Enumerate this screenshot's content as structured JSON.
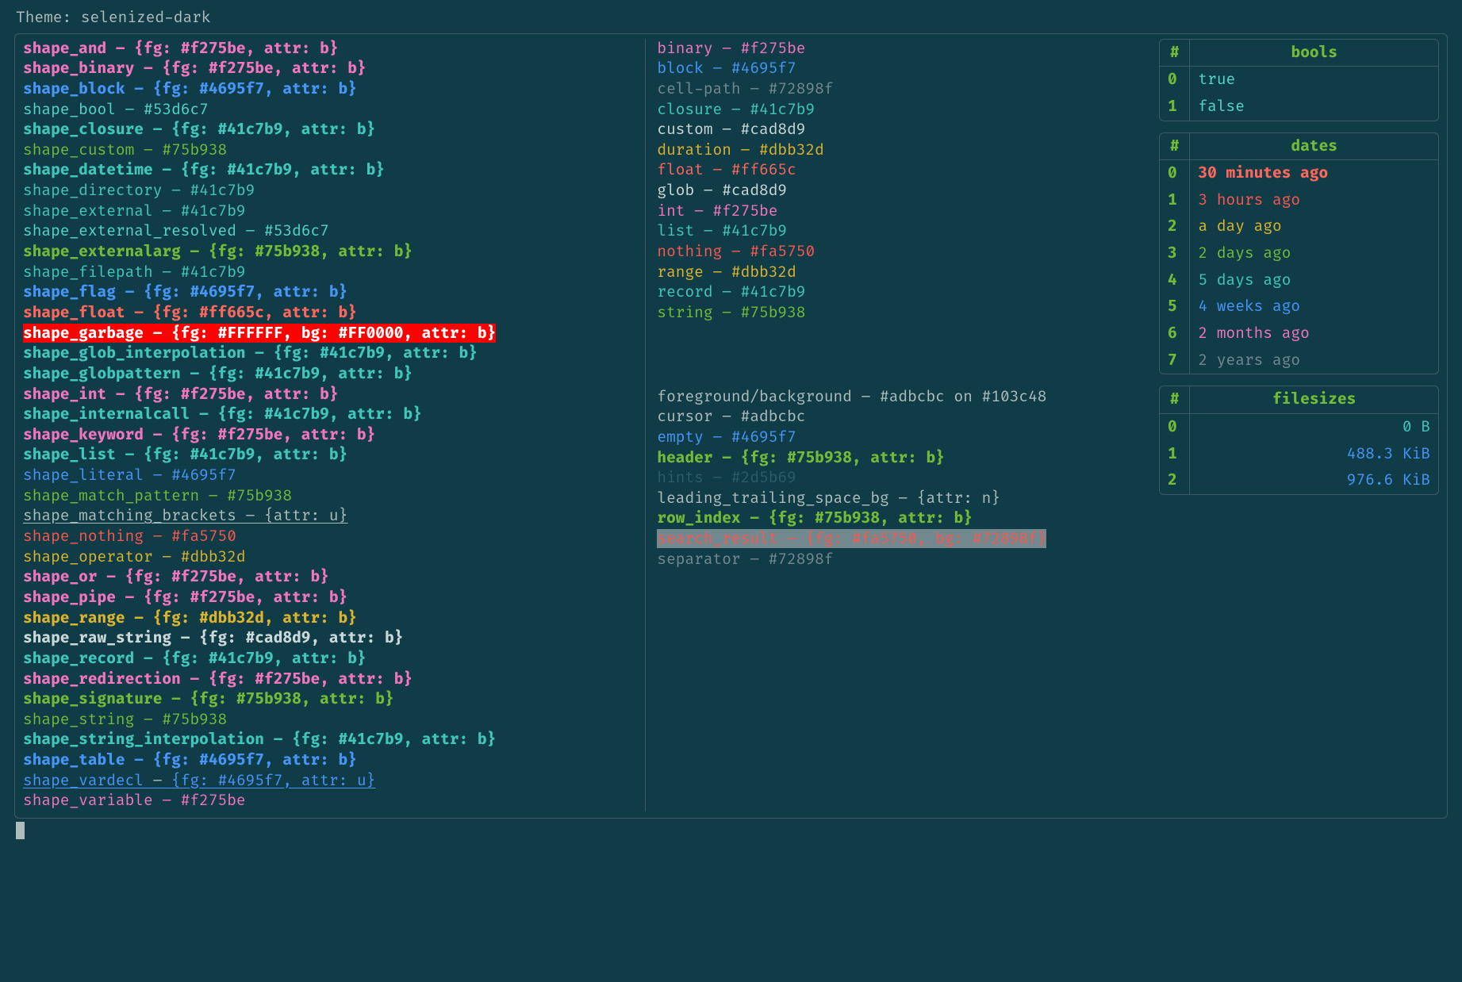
{
  "theme_label": "Theme: ",
  "theme_name": "selenized-dark",
  "colors": {
    "bg": "#103c48",
    "fg": "#adbcbc",
    "muted": "#72898f",
    "green": "#75b938",
    "cyan": "#41c7b9",
    "brcyan": "#53d6c7",
    "blue": "#4695f7",
    "magenta": "#f275be",
    "yellow": "#dbb32d",
    "red": "#fa5750",
    "brred": "#ff665c",
    "white": "#cad8d9",
    "dim": "#2d5b69"
  },
  "shapes": [
    {
      "name": "shape_and",
      "value": "{fg: #f275be, attr: b}",
      "c": "magenta",
      "b": true
    },
    {
      "name": "shape_binary",
      "value": "{fg: #f275be, attr: b}",
      "c": "magenta",
      "b": true
    },
    {
      "name": "shape_block",
      "value": "{fg: #4695f7, attr: b}",
      "c": "blue",
      "b": true
    },
    {
      "name": "shape_bool",
      "value": "#53d6c7",
      "c": "brcyan",
      "b": false
    },
    {
      "name": "shape_closure",
      "value": "{fg: #41c7b9, attr: b}",
      "c": "cyan",
      "b": true
    },
    {
      "name": "shape_custom",
      "value": "#75b938",
      "c": "green",
      "b": false
    },
    {
      "name": "shape_datetime",
      "value": "{fg: #41c7b9, attr: b}",
      "c": "cyan",
      "b": true
    },
    {
      "name": "shape_directory",
      "value": "#41c7b9",
      "c": "cyan",
      "b": false
    },
    {
      "name": "shape_external",
      "value": "#41c7b9",
      "c": "cyan",
      "b": false
    },
    {
      "name": "shape_external_resolved",
      "value": "#53d6c7",
      "c": "brcyan",
      "b": false
    },
    {
      "name": "shape_externalarg",
      "value": "{fg: #75b938, attr: b}",
      "c": "green",
      "b": true
    },
    {
      "name": "shape_filepath",
      "value": "#41c7b9",
      "c": "cyan",
      "b": false
    },
    {
      "name": "shape_flag",
      "value": "{fg: #4695f7, attr: b}",
      "c": "blue",
      "b": true
    },
    {
      "name": "shape_float",
      "value": "{fg: #ff665c, attr: b}",
      "c": "brred",
      "b": true
    },
    {
      "name": "shape_garbage",
      "value": "{fg: #FFFFFF, bg: #FF0000, attr: b}",
      "c": "#FFFFFF",
      "bg": "#FF0000",
      "b": true
    },
    {
      "name": "shape_glob_interpolation",
      "value": "{fg: #41c7b9, attr: b}",
      "c": "cyan",
      "b": true
    },
    {
      "name": "shape_globpattern",
      "value": "{fg: #41c7b9, attr: b}",
      "c": "cyan",
      "b": true
    },
    {
      "name": "shape_int",
      "value": "{fg: #f275be, attr: b}",
      "c": "magenta",
      "b": true
    },
    {
      "name": "shape_internalcall",
      "value": "{fg: #41c7b9, attr: b}",
      "c": "cyan",
      "b": true
    },
    {
      "name": "shape_keyword",
      "value": "{fg: #f275be, attr: b}",
      "c": "magenta",
      "b": true
    },
    {
      "name": "shape_list",
      "value": "{fg: #41c7b9, attr: b}",
      "c": "cyan",
      "b": true
    },
    {
      "name": "shape_literal",
      "value": "#4695f7",
      "c": "blue",
      "b": false
    },
    {
      "name": "shape_match_pattern",
      "value": "#75b938",
      "c": "green",
      "b": false
    },
    {
      "name": "shape_matching_brackets",
      "value": "{attr: u}",
      "c": "fg",
      "b": false,
      "u": true
    },
    {
      "name": "shape_nothing",
      "value": "#fa5750",
      "c": "red",
      "b": false
    },
    {
      "name": "shape_operator",
      "value": "#dbb32d",
      "c": "yellow",
      "b": false
    },
    {
      "name": "shape_or",
      "value": "{fg: #f275be, attr: b}",
      "c": "magenta",
      "b": true
    },
    {
      "name": "shape_pipe",
      "value": "{fg: #f275be, attr: b}",
      "c": "magenta",
      "b": true
    },
    {
      "name": "shape_range",
      "value": "{fg: #dbb32d, attr: b}",
      "c": "yellow",
      "b": true
    },
    {
      "name": "shape_raw_string",
      "value": "{fg: #cad8d9, attr: b}",
      "c": "white",
      "b": true
    },
    {
      "name": "shape_record",
      "value": "{fg: #41c7b9, attr: b}",
      "c": "cyan",
      "b": true
    },
    {
      "name": "shape_redirection",
      "value": "{fg: #f275be, attr: b}",
      "c": "magenta",
      "b": true
    },
    {
      "name": "shape_signature",
      "value": "{fg: #75b938, attr: b}",
      "c": "green",
      "b": true
    },
    {
      "name": "shape_string",
      "value": "#75b938",
      "c": "green",
      "b": false
    },
    {
      "name": "shape_string_interpolation",
      "value": "{fg: #41c7b9, attr: b}",
      "c": "cyan",
      "b": true
    },
    {
      "name": "shape_table",
      "value": "{fg: #4695f7, attr: b}",
      "c": "blue",
      "b": true
    },
    {
      "name": "shape_vardecl",
      "value": "{fg: #4695f7, attr: u}",
      "c": "blue",
      "b": false,
      "u": true
    },
    {
      "name": "shape_variable",
      "value": "#f275be",
      "c": "magenta",
      "b": false
    }
  ],
  "types": [
    {
      "name": "binary",
      "value": "#f275be",
      "c": "magenta"
    },
    {
      "name": "block",
      "value": "#4695f7",
      "c": "blue"
    },
    {
      "name": "cell-path",
      "value": "#72898f",
      "c": "muted"
    },
    {
      "name": "closure",
      "value": "#41c7b9",
      "c": "cyan"
    },
    {
      "name": "custom",
      "value": "#cad8d9",
      "c": "white"
    },
    {
      "name": "duration",
      "value": "#dbb32d",
      "c": "yellow"
    },
    {
      "name": "float",
      "value": "#ff665c",
      "c": "brred"
    },
    {
      "name": "glob",
      "value": "#cad8d9",
      "c": "white"
    },
    {
      "name": "int",
      "value": "#f275be",
      "c": "magenta"
    },
    {
      "name": "list",
      "value": "#41c7b9",
      "c": "cyan"
    },
    {
      "name": "nothing",
      "value": "#fa5750",
      "c": "red"
    },
    {
      "name": "range",
      "value": "#dbb32d",
      "c": "yellow"
    },
    {
      "name": "record",
      "value": "#41c7b9",
      "c": "cyan"
    },
    {
      "name": "string",
      "value": "#75b938",
      "c": "green"
    }
  ],
  "misc": [
    {
      "name": "foreground/background",
      "value": "#adbcbc on #103c48",
      "c": "fg"
    },
    {
      "name": "cursor",
      "value": "#adbcbc",
      "c": "fg"
    },
    {
      "name": "empty",
      "value": "#4695f7",
      "c": "blue"
    },
    {
      "name": "header",
      "value": "{fg: #75b938, attr: b}",
      "c": "green",
      "b": true
    },
    {
      "name": "hints",
      "value": "#2d5b69",
      "c": "dim"
    },
    {
      "name": "leading_trailing_space_bg",
      "value": "{attr: n}",
      "c": "fg"
    },
    {
      "name": "row_index",
      "value": "{fg: #75b938, attr: b}",
      "c": "green",
      "b": true
    },
    {
      "name": "search_result",
      "value": "{fg: #fa5750, bg: #72898f}",
      "c": "red",
      "bg": "#72898f"
    },
    {
      "name": "separator",
      "value": "#72898f",
      "c": "muted"
    }
  ],
  "tables": {
    "bools": {
      "headers": [
        "#",
        "bools"
      ],
      "rows": [
        {
          "i": "0",
          "v": "true",
          "c": "brcyan"
        },
        {
          "i": "1",
          "v": "false",
          "c": "brcyan"
        }
      ]
    },
    "dates": {
      "headers": [
        "#",
        "dates"
      ],
      "rows": [
        {
          "i": "0",
          "v": "30 minutes ago",
          "c": "brred",
          "b": true
        },
        {
          "i": "1",
          "v": "3 hours ago",
          "c": "red"
        },
        {
          "i": "2",
          "v": "a day ago",
          "c": "yellow"
        },
        {
          "i": "3",
          "v": "2 days ago",
          "c": "green"
        },
        {
          "i": "4",
          "v": "5 days ago",
          "c": "cyan"
        },
        {
          "i": "5",
          "v": "4 weeks ago",
          "c": "blue"
        },
        {
          "i": "6",
          "v": "2 months ago",
          "c": "magenta"
        },
        {
          "i": "7",
          "v": "2 years ago",
          "c": "muted"
        }
      ]
    },
    "filesizes": {
      "headers": [
        "#",
        "filesizes"
      ],
      "rows": [
        {
          "i": "0",
          "v": "0 B",
          "c": "cyan",
          "right": true
        },
        {
          "i": "1",
          "v": "488.3 KiB",
          "c": "blue",
          "right": true
        },
        {
          "i": "2",
          "v": "976.6 KiB",
          "c": "blue",
          "right": true
        }
      ]
    }
  }
}
